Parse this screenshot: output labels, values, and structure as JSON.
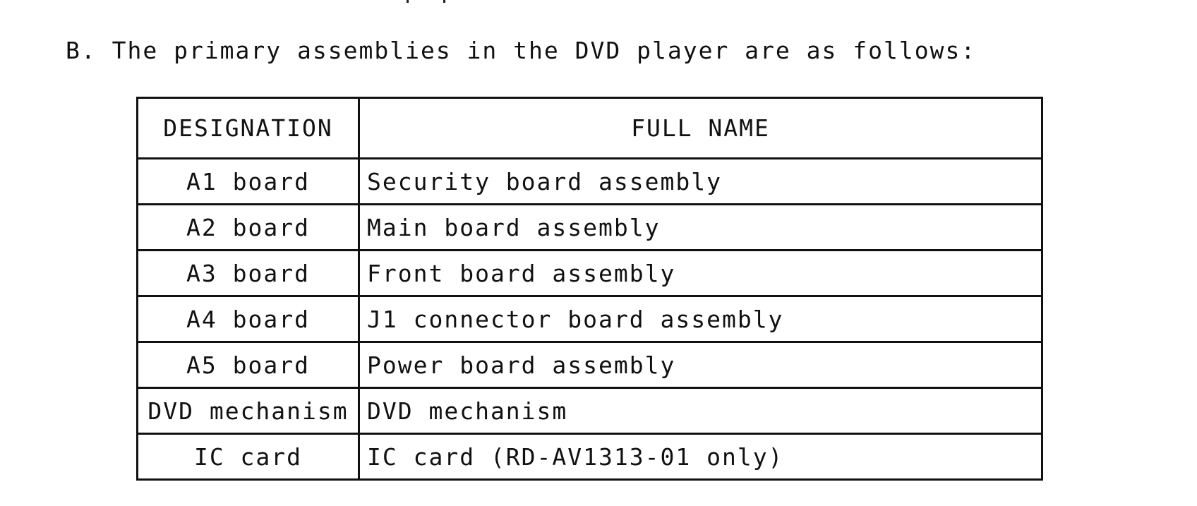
{
  "intro": {
    "text": "B. The primary assemblies in the DVD player are as follows:"
  },
  "table": {
    "headers": [
      "DESIGNATION",
      "FULL NAME"
    ],
    "rows": [
      [
        "A1 board",
        "Security board assembly"
      ],
      [
        "A2 board",
        "Main board assembly"
      ],
      [
        "A3 board",
        "Front board assembly"
      ],
      [
        "A4 board",
        "J1 connector board assembly"
      ],
      [
        "A5 board",
        "Power board assembly"
      ],
      [
        "DVD mechanism",
        "DVD mechanism"
      ],
      [
        "IC card",
        "IC card (RD-AV1313-01 only)"
      ]
    ]
  }
}
